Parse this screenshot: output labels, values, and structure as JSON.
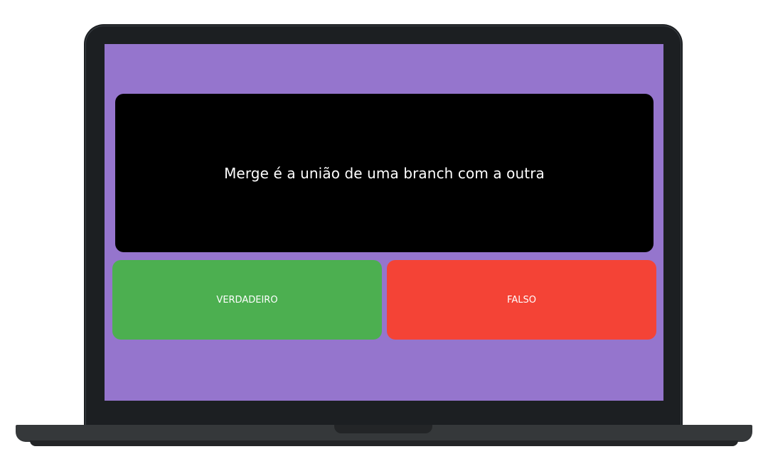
{
  "quiz": {
    "question": "Merge é a união de uma branch com a outra",
    "true_label": "VERDADEIRO",
    "false_label": "FALSO"
  },
  "colors": {
    "screen_background": "#9575cd",
    "question_background": "#000000",
    "true_button": "#4caf50",
    "false_button": "#f44336",
    "laptop_body": "#1c1f22",
    "laptop_base": "#35383a"
  }
}
